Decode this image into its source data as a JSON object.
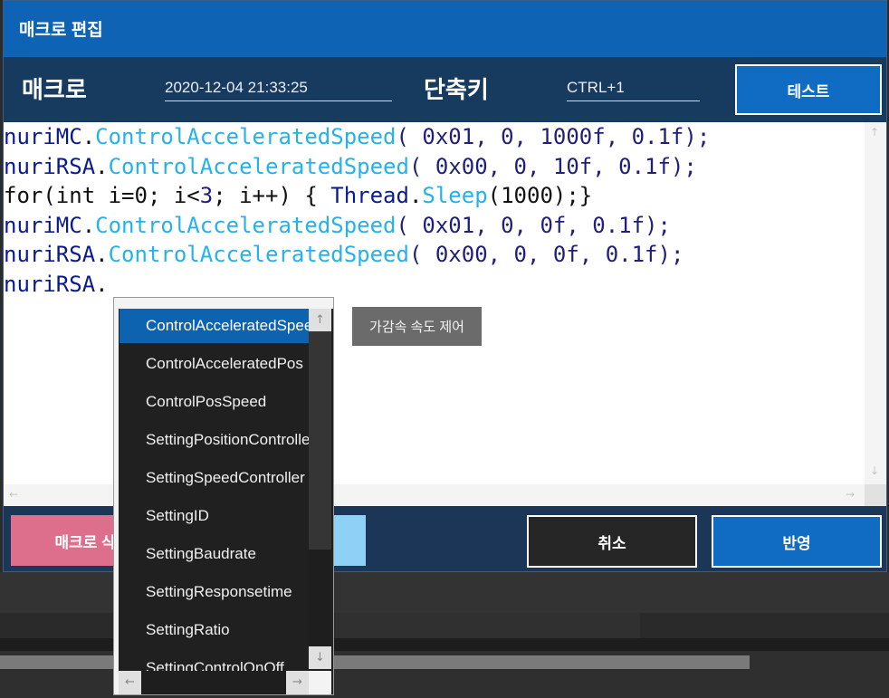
{
  "window": {
    "title": "매크로 편집"
  },
  "header": {
    "macro_label": "매크로",
    "macro_value": "2020-12-04 21:33:25",
    "shortcut_label": "단축키",
    "shortcut_value": "CTRL+1",
    "test_button": "테스트"
  },
  "code_lines": [
    [
      {
        "t": "nuriMC",
        "c": "obj"
      },
      {
        "t": ".",
        "c": "plain"
      },
      {
        "t": "ControlAcceleratedSpeed",
        "c": "mem"
      },
      {
        "t": "( 0x01, 0, 1000f, 0.1f);",
        "c": "num"
      }
    ],
    [
      {
        "t": "nuriRSA",
        "c": "obj"
      },
      {
        "t": ".",
        "c": "plain"
      },
      {
        "t": "ControlAcceleratedSpeed",
        "c": "mem"
      },
      {
        "t": "( 0x00, 0, 10f, 0.1f);",
        "c": "num"
      }
    ],
    [
      {
        "t": "for(int i=0; i<",
        "c": "plain"
      },
      {
        "t": "3",
        "c": "num"
      },
      {
        "t": "; i++) { ",
        "c": "plain"
      },
      {
        "t": "Thread",
        "c": "obj"
      },
      {
        "t": ".",
        "c": "plain"
      },
      {
        "t": "Sleep",
        "c": "mem"
      },
      {
        "t": "(1000);}",
        "c": "plain"
      }
    ],
    [
      {
        "t": "nuriMC",
        "c": "obj"
      },
      {
        "t": ".",
        "c": "plain"
      },
      {
        "t": "ControlAcceleratedSpeed",
        "c": "mem"
      },
      {
        "t": "( 0x01, 0, 0f, 0.1f);",
        "c": "num"
      }
    ],
    [
      {
        "t": "nuriRSA",
        "c": "obj"
      },
      {
        "t": ".",
        "c": "plain"
      },
      {
        "t": "ControlAcceleratedSpeed",
        "c": "mem"
      },
      {
        "t": "( 0x00, 0, 0f, 0.1f);",
        "c": "num"
      }
    ],
    [
      {
        "t": "nuriRSA",
        "c": "obj"
      },
      {
        "t": ".",
        "c": "plain"
      }
    ]
  ],
  "autocomplete": {
    "items": [
      "ControlAcceleratedSpeed",
      "ControlAcceleratedPos",
      "ControlPosSpeed",
      "SettingPositionController",
      "SettingSpeedController",
      "SettingID",
      "SettingBaudrate",
      "SettingResponsetime",
      "SettingRatio",
      "SettingControlOnOff"
    ],
    "selected_index": 0,
    "tooltip": "가감속 속도 제어"
  },
  "footer": {
    "left_button": "매크로 삭제",
    "cancel_button": "취소",
    "apply_button": "반영"
  },
  "icons": {
    "up": "↑",
    "down": "↓",
    "left": "←",
    "right": "→"
  },
  "colors": {
    "titlebar": "#0f63b4",
    "accent_button": "#0f6cc2",
    "danger_button": "#de6f8c",
    "selection": "#0d63b0"
  }
}
